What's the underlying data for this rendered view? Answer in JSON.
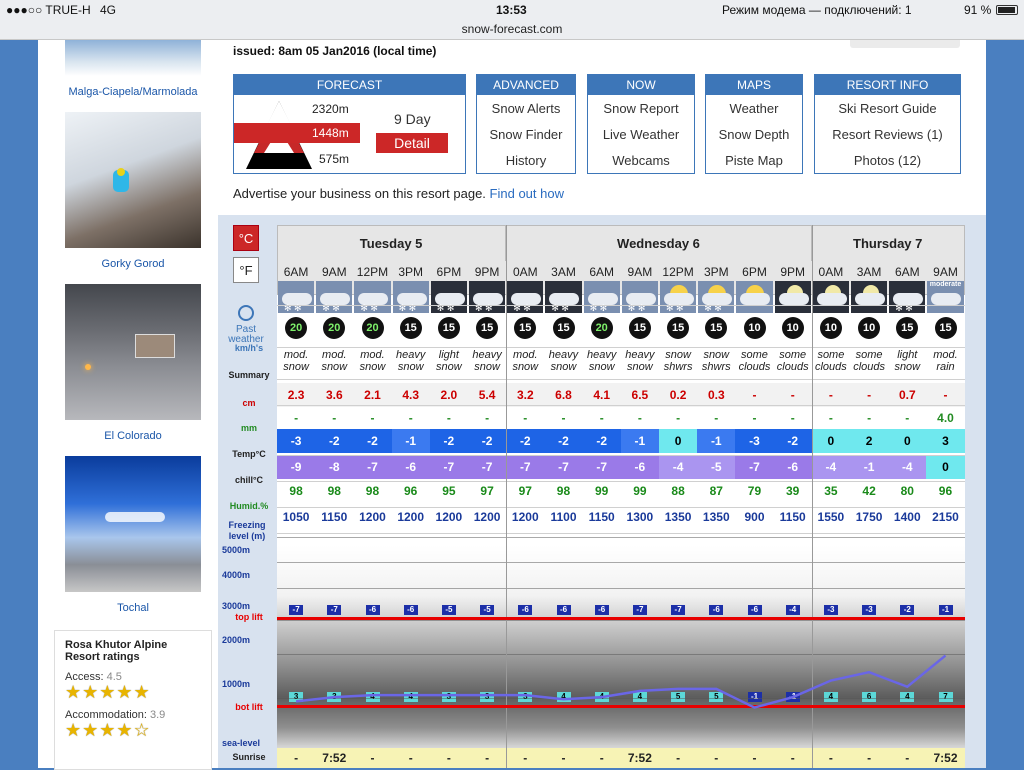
{
  "status_bar": {
    "carrier": "●●●○○ TRUE-H",
    "network": "4G",
    "time": "13:53",
    "tether": "Режим модема — подключений: 1",
    "battery": "91 %"
  },
  "url": "snow-forecast.com",
  "sidebar": {
    "resorts": [
      {
        "name": "Malga-Ciapela/Marmolada"
      },
      {
        "name": "Gorky Gorod"
      },
      {
        "name": "El Colorado"
      },
      {
        "name": "Tochal"
      }
    ],
    "ratings": {
      "title": "Rosa Khutor Alpine Resort ratings",
      "access_label": "Access:",
      "access_value": "4.5",
      "access_stars": "★★★★★",
      "accommodation_label": "Accommodation:",
      "accommodation_value": "3.9",
      "accommodation_stars": "★★★★☆"
    }
  },
  "header": {
    "issued": "issued: 8am 05 Jan2016 (local time)"
  },
  "nav": {
    "forecast": {
      "title": "FORECAST",
      "elev_top": "2320m",
      "elev_mid": "1448m",
      "elev_bot": "575m",
      "nine_day": "9 Day",
      "detail": "Detail"
    },
    "advanced": {
      "title": "ADVANCED",
      "links": [
        "Snow Alerts",
        "Snow Finder",
        "History"
      ]
    },
    "now": {
      "title": "NOW",
      "links": [
        "Snow Report",
        "Live Weather",
        "Webcams"
      ]
    },
    "maps": {
      "title": "MAPS",
      "links": [
        "Weather",
        "Snow Depth",
        "Piste Map"
      ]
    },
    "resort_info": {
      "title": "RESORT INFO",
      "links": [
        "Ski Resort Guide",
        "Resort Reviews (1)",
        "Photos (12)"
      ]
    }
  },
  "advert": {
    "text": "Advertise your business on this resort page.",
    "link": "Find out how"
  },
  "units": {
    "celsius": "°C",
    "fahrenheit": "°F"
  },
  "row_labels": {
    "past_weather": "Past weather",
    "wind": "km/h's",
    "summary": "Summary",
    "snow": "cm",
    "rain": "mm",
    "temp": "Temp°C",
    "chill": "chill°C",
    "humid": "Humid.%",
    "freezing": "Freezing level (m)",
    "alt_5000": "5000m",
    "alt_4000": "4000m",
    "alt_3000": "3000m",
    "alt_2000": "2000m",
    "alt_1000": "1000m",
    "sea_level": "sea-level",
    "top_lift": "top lift",
    "bot_lift": "bot lift",
    "sunrise": "Sunrise"
  },
  "days": [
    {
      "name": "Tuesday 5",
      "count": 6
    },
    {
      "name": "Wednesday 6",
      "count": 8
    },
    {
      "name": "Thursday 7",
      "count": 4
    }
  ],
  "columns": [
    {
      "time": "6AM",
      "wind": "20",
      "summary": "mod. snow",
      "snow": "2.3",
      "rain": "-",
      "temp": "-3",
      "chill": "-9",
      "humid": "98",
      "freeze": "1050",
      "top": "-7",
      "bot": "3",
      "sunrise": "-",
      "icon": "snow"
    },
    {
      "time": "9AM",
      "wind": "20",
      "summary": "mod. snow",
      "snow": "3.6",
      "rain": "-",
      "temp": "-2",
      "chill": "-8",
      "humid": "98",
      "freeze": "1150",
      "top": "-7",
      "bot": "3",
      "sunrise": "7:52",
      "icon": "snow"
    },
    {
      "time": "12PM",
      "wind": "20",
      "summary": "mod. snow",
      "snow": "2.1",
      "rain": "-",
      "temp": "-2",
      "chill": "-7",
      "humid": "98",
      "freeze": "1200",
      "top": "-6",
      "bot": "4",
      "sunrise": "-",
      "icon": "snow"
    },
    {
      "time": "3PM",
      "wind": "15",
      "summary": "heavy snow",
      "snow": "4.3",
      "rain": "-",
      "temp": "-1",
      "chill": "-6",
      "humid": "96",
      "freeze": "1200",
      "top": "-6",
      "bot": "4",
      "sunrise": "-",
      "icon": "snow"
    },
    {
      "time": "6PM",
      "wind": "15",
      "summary": "light snow",
      "snow": "2.0",
      "rain": "-",
      "temp": "-2",
      "chill": "-7",
      "humid": "95",
      "freeze": "1200",
      "top": "-5",
      "bot": "3",
      "sunrise": "-",
      "icon": "snow_night"
    },
    {
      "time": "9PM",
      "wind": "15",
      "summary": "heavy snow",
      "snow": "5.4",
      "rain": "-",
      "temp": "-2",
      "chill": "-7",
      "humid": "97",
      "freeze": "1200",
      "top": "-5",
      "bot": "3",
      "sunrise": "-",
      "icon": "snow_night"
    },
    {
      "time": "0AM",
      "wind": "15",
      "summary": "mod. snow",
      "snow": "3.2",
      "rain": "-",
      "temp": "-2",
      "chill": "-7",
      "humid": "97",
      "freeze": "1200",
      "top": "-6",
      "bot": "3",
      "sunrise": "-",
      "icon": "snow_night"
    },
    {
      "time": "3AM",
      "wind": "15",
      "summary": "heavy snow",
      "snow": "6.8",
      "rain": "-",
      "temp": "-2",
      "chill": "-7",
      "humid": "98",
      "freeze": "1100",
      "top": "-6",
      "bot": "4",
      "sunrise": "-",
      "icon": "snow_night"
    },
    {
      "time": "6AM",
      "wind": "20",
      "summary": "heavy snow",
      "snow": "4.1",
      "rain": "-",
      "temp": "-2",
      "chill": "-7",
      "humid": "99",
      "freeze": "1150",
      "top": "-6",
      "bot": "4",
      "sunrise": "-",
      "icon": "snow"
    },
    {
      "time": "9AM",
      "wind": "15",
      "summary": "heavy snow",
      "snow": "6.5",
      "rain": "-",
      "temp": "-1",
      "chill": "-6",
      "humid": "99",
      "freeze": "1300",
      "top": "-7",
      "bot": "4",
      "sunrise": "7:52",
      "icon": "snow"
    },
    {
      "time": "12PM",
      "wind": "15",
      "summary": "snow shwrs",
      "snow": "0.2",
      "rain": "-",
      "temp": "0",
      "chill": "-4",
      "humid": "88",
      "freeze": "1350",
      "top": "-7",
      "bot": "5",
      "sunrise": "-",
      "icon": "sun_snow"
    },
    {
      "time": "3PM",
      "wind": "15",
      "summary": "snow shwrs",
      "snow": "0.3",
      "rain": "-",
      "temp": "-1",
      "chill": "-5",
      "humid": "87",
      "freeze": "1350",
      "top": "-6",
      "bot": "5",
      "sunrise": "-",
      "icon": "sun_snow"
    },
    {
      "time": "6PM",
      "wind": "10",
      "summary": "some clouds",
      "snow": "-",
      "rain": "-",
      "temp": "-3",
      "chill": "-7",
      "humid": "79",
      "freeze": "900",
      "top": "-6",
      "bot": "-1",
      "sunrise": "-",
      "icon": "sun_cloud"
    },
    {
      "time": "9PM",
      "wind": "10",
      "summary": "some clouds",
      "snow": "-",
      "rain": "-",
      "temp": "-2",
      "chill": "-6",
      "humid": "39",
      "freeze": "1150",
      "top": "-4",
      "bot": "-1",
      "sunrise": "-",
      "icon": "moon_cloud"
    },
    {
      "time": "0AM",
      "wind": "10",
      "summary": "some clouds",
      "snow": "-",
      "rain": "-",
      "temp": "0",
      "chill": "-4",
      "humid": "35",
      "freeze": "1550",
      "top": "-3",
      "bot": "4",
      "sunrise": "-",
      "icon": "moon_cloud"
    },
    {
      "time": "3AM",
      "wind": "10",
      "summary": "some clouds",
      "snow": "-",
      "rain": "-",
      "temp": "2",
      "chill": "-1",
      "humid": "42",
      "freeze": "1750",
      "top": "-3",
      "bot": "6",
      "sunrise": "-",
      "icon": "moon_cloud"
    },
    {
      "time": "6AM",
      "wind": "15",
      "summary": "light snow",
      "snow": "0.7",
      "rain": "-",
      "temp": "0",
      "chill": "-4",
      "humid": "80",
      "freeze": "1400",
      "top": "-2",
      "bot": "4",
      "sunrise": "-",
      "icon": "snow_night"
    },
    {
      "time": "9AM",
      "wind": "15",
      "summary": "mod. rain",
      "snow": "-",
      "rain": "4.0",
      "temp": "3",
      "chill": "0",
      "humid": "96",
      "freeze": "2150",
      "top": "-1",
      "bot": "7",
      "sunrise": "7:52",
      "icon": "rain",
      "icon_label": "moderate"
    }
  ],
  "colors": {
    "nav": "#3d76b8",
    "snow_text": "#cc0000",
    "rain_text": "#228b22",
    "humid_text": "#1a8a1a",
    "freeze_text": "#1a3a9a",
    "temp_blue_dark": "#1e64e6",
    "temp_blue_mid": "#3b7af0",
    "temp_cyan": "#6fe8ee",
    "chill_purple": "#9a7ae8",
    "chill_light": "#aa95f0",
    "lift_line": "#e80000",
    "freeze_line": "#6a66e6"
  }
}
